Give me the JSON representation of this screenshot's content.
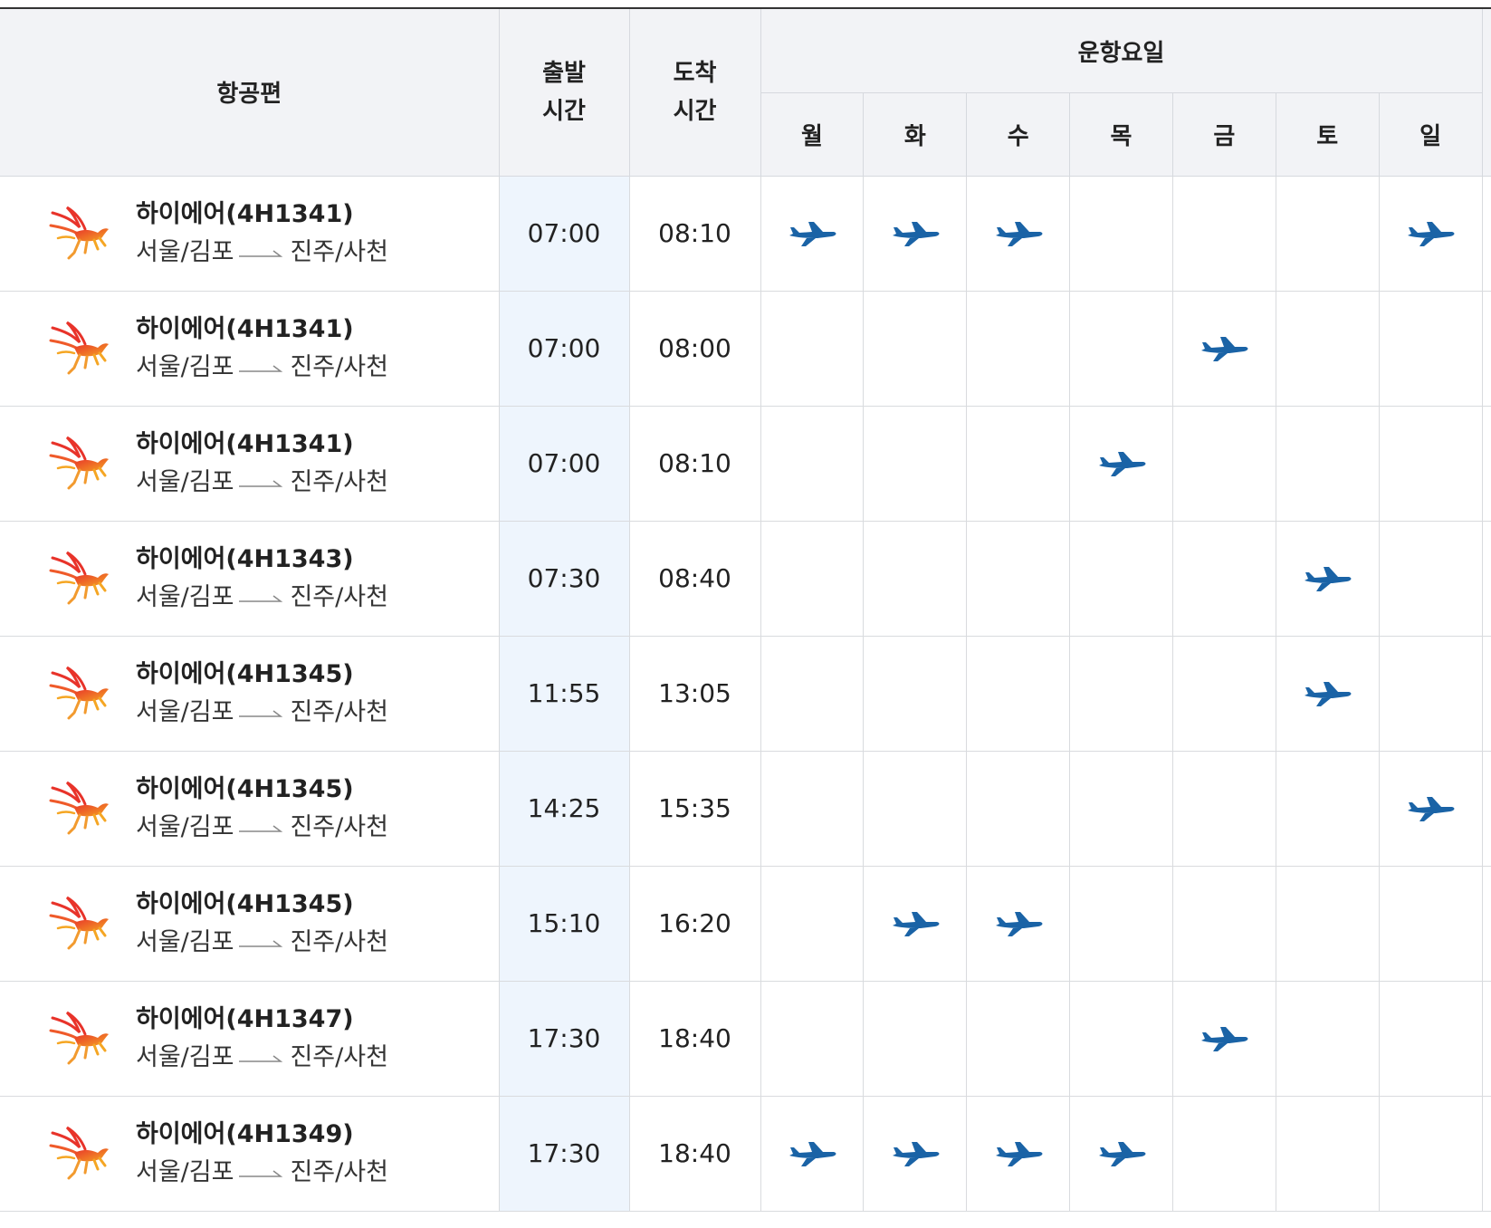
{
  "table": {
    "headers": {
      "flight": "항공편",
      "departure_line1": "출발",
      "departure_line2": "시간",
      "arrival_line1": "도착",
      "arrival_line2": "시간",
      "operating_days": "운항요일",
      "days": [
        "월",
        "화",
        "수",
        "목",
        "금",
        "토",
        "일"
      ]
    },
    "rows": [
      {
        "flight": "하이에어(4H1341)",
        "origin": "서울/김포",
        "destination": "진주/사천",
        "departure": "07:00",
        "arrival": "08:10",
        "days": [
          true,
          true,
          true,
          false,
          false,
          false,
          true
        ]
      },
      {
        "flight": "하이에어(4H1341)",
        "origin": "서울/김포",
        "destination": "진주/사천",
        "departure": "07:00",
        "arrival": "08:00",
        "days": [
          false,
          false,
          false,
          false,
          true,
          false,
          false
        ]
      },
      {
        "flight": "하이에어(4H1341)",
        "origin": "서울/김포",
        "destination": "진주/사천",
        "departure": "07:00",
        "arrival": "08:10",
        "days": [
          false,
          false,
          false,
          true,
          false,
          false,
          false
        ]
      },
      {
        "flight": "하이에어(4H1343)",
        "origin": "서울/김포",
        "destination": "진주/사천",
        "departure": "07:30",
        "arrival": "08:40",
        "days": [
          false,
          false,
          false,
          false,
          false,
          true,
          false
        ]
      },
      {
        "flight": "하이에어(4H1345)",
        "origin": "서울/김포",
        "destination": "진주/사천",
        "departure": "11:55",
        "arrival": "13:05",
        "days": [
          false,
          false,
          false,
          false,
          false,
          true,
          false
        ]
      },
      {
        "flight": "하이에어(4H1345)",
        "origin": "서울/김포",
        "destination": "진주/사천",
        "departure": "14:25",
        "arrival": "15:35",
        "days": [
          false,
          false,
          false,
          false,
          false,
          false,
          true
        ]
      },
      {
        "flight": "하이에어(4H1345)",
        "origin": "서울/김포",
        "destination": "진주/사천",
        "departure": "15:10",
        "arrival": "16:20",
        "days": [
          false,
          true,
          true,
          false,
          false,
          false,
          false
        ]
      },
      {
        "flight": "하이에어(4H1347)",
        "origin": "서울/김포",
        "destination": "진주/사천",
        "departure": "17:30",
        "arrival": "18:40",
        "days": [
          false,
          false,
          false,
          false,
          true,
          false,
          false
        ]
      },
      {
        "flight": "하이에어(4H1349)",
        "origin": "서울/김포",
        "destination": "진주/사천",
        "departure": "17:30",
        "arrival": "18:40",
        "days": [
          true,
          true,
          true,
          true,
          false,
          false,
          false
        ]
      }
    ]
  },
  "icons": {
    "airline_logo": "hi-air-pegasus-logo-icon",
    "route_arrow": "route-arrow-icon",
    "operating_marker": "airplane-icon"
  },
  "colors": {
    "header_bg": "#f2f3f6",
    "departure_col_bg": "#eef5fd",
    "plane_blue": "#1a63a6",
    "logo_red": "#e8332a",
    "logo_orange": "#f5a623"
  }
}
